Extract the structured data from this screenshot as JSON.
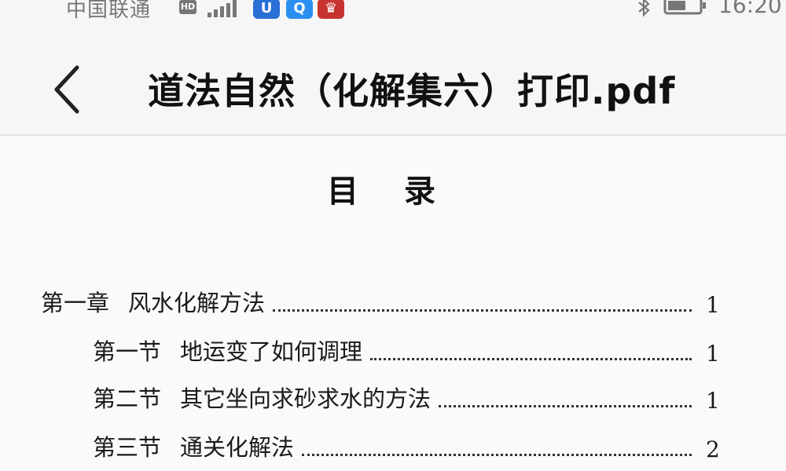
{
  "status_bar": {
    "carrier": "中国联通",
    "hd_badge": "HD",
    "apps": [
      "U",
      "Q",
      "♛"
    ],
    "time": "16:20"
  },
  "header": {
    "title": "道法自然（化解集六）打印.pdf"
  },
  "toc": {
    "heading": "目录",
    "entries": [
      {
        "label": "第一章",
        "text": "风水化解方法",
        "page": "1"
      },
      {
        "label": "第一节",
        "text": "地运变了如何调理",
        "page": "1"
      },
      {
        "label": "第二节",
        "text": "其它坐向求砂求水的方法",
        "page": "1"
      },
      {
        "label": "第三节",
        "text": "通关化解法",
        "page": "2"
      }
    ]
  }
}
